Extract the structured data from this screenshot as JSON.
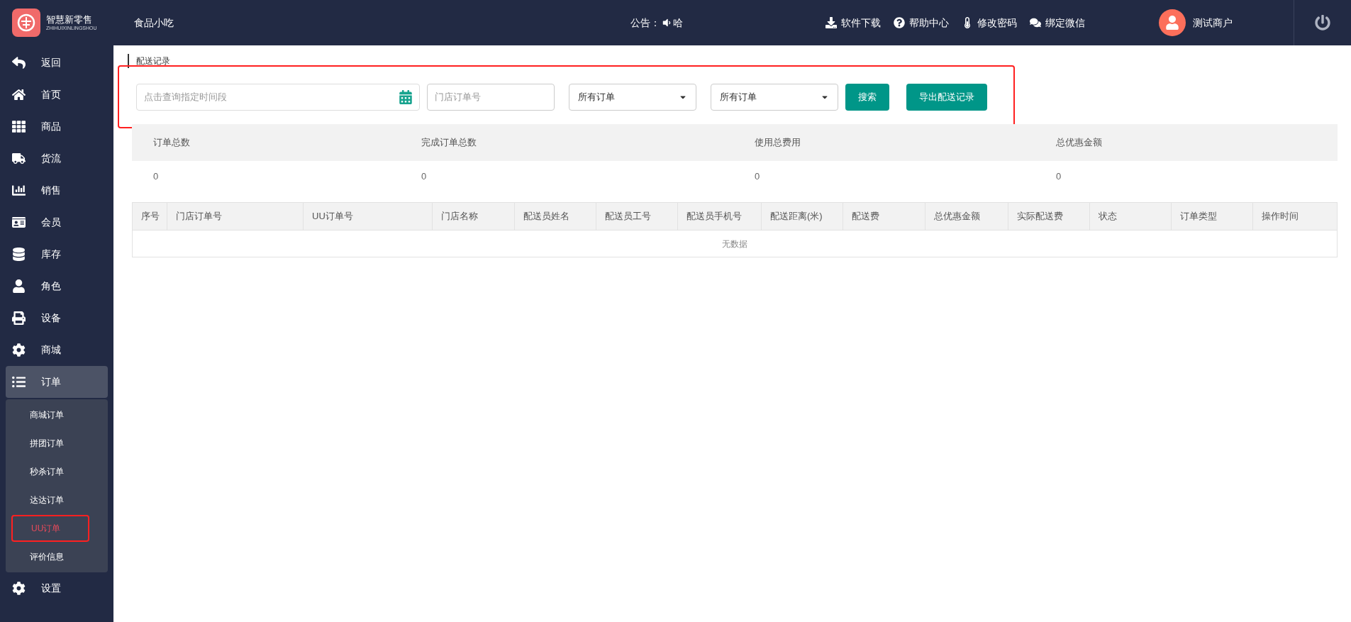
{
  "header": {
    "logo_text": "智慧新零售",
    "logo_subtext": "ZHIHUIXINLINGSHOU",
    "store": "食品小吃",
    "notice_label": "公告：",
    "notice_text": "哈",
    "links": [
      {
        "kind": "download",
        "label": "软件下载"
      },
      {
        "kind": "help",
        "label": "帮助中心"
      },
      {
        "kind": "password",
        "label": "修改密码"
      },
      {
        "kind": "wechat",
        "label": "绑定微信"
      }
    ],
    "user": "测试商户"
  },
  "sidebar": {
    "items": [
      {
        "kind": "back",
        "label": "返回",
        "selected": false
      },
      {
        "kind": "home",
        "label": "首页",
        "selected": false
      },
      {
        "kind": "grid",
        "label": "商品",
        "selected": false
      },
      {
        "kind": "truck",
        "label": "货流",
        "selected": false
      },
      {
        "kind": "chart",
        "label": "销售",
        "selected": false
      },
      {
        "kind": "card",
        "label": "会员",
        "selected": false
      },
      {
        "kind": "database",
        "label": "库存",
        "selected": false
      },
      {
        "kind": "user",
        "label": "角色",
        "selected": false
      },
      {
        "kind": "printer",
        "label": "设备",
        "selected": false
      },
      {
        "kind": "gear",
        "label": "商城",
        "selected": false
      },
      {
        "kind": "list",
        "label": "订单",
        "selected": true,
        "expanded": true,
        "children": [
          {
            "label": "商城订单",
            "selected": false,
            "highlighted": false
          },
          {
            "label": "拼团订单",
            "selected": false,
            "highlighted": false
          },
          {
            "label": "秒杀订单",
            "selected": false,
            "highlighted": false
          },
          {
            "label": "达达订单",
            "selected": false,
            "highlighted": false
          },
          {
            "label": "UU订单",
            "selected": true,
            "highlighted": true
          },
          {
            "label": "评价信息",
            "selected": false,
            "highlighted": false
          }
        ]
      },
      {
        "kind": "gear",
        "label": "设置",
        "selected": false
      }
    ]
  },
  "breadcrumb": "配送记录",
  "filters": {
    "highlighted": true,
    "date": {
      "placeholder": "点击查询指定时间段"
    },
    "order_no": {
      "placeholder": "门店订单号"
    },
    "selects": [
      "所有订单",
      "所有订单"
    ],
    "search_button": "搜索",
    "export_button": "导出配送记录"
  },
  "stats": [
    {
      "label": "订单总数",
      "value": "0"
    },
    {
      "label": "完成订单总数",
      "value": "0"
    },
    {
      "label": "使用总费用",
      "value": "0"
    },
    {
      "label": "总优惠金额",
      "value": "0"
    }
  ],
  "table": {
    "columns": [
      "序号",
      "门店订单号",
      "UU订单号",
      "门店名称",
      "配送员姓名",
      "配送员工号",
      "配送员手机号",
      "配送距离(米)",
      "配送费",
      "总优惠金额",
      "实际配送费",
      "状态",
      "订单类型",
      "操作时间"
    ],
    "empty_text": "无数据"
  }
}
